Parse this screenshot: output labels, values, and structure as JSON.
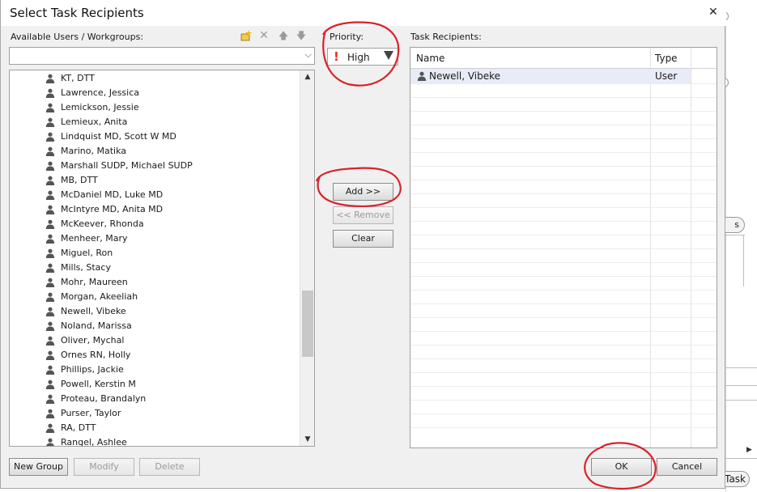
{
  "dialog": {
    "title": "Select Task Recipients",
    "close_glyph": "✕"
  },
  "available": {
    "label": "Available Users / Workgroups:",
    "search_value": "",
    "users": [
      "KT, DTT",
      "Lawrence, Jessica",
      "Lemickson, Jessie",
      "Lemieux, Anita",
      "Lindquist MD, Scott W MD",
      "Marino, Matika",
      "Marshall SUDP, Michael SUDP",
      "MB, DTT",
      "McDaniel MD, Luke MD",
      "McIntyre MD, Anita MD",
      "McKeever, Rhonda",
      "Menheer, Mary",
      "Miguel, Ron",
      "Mills, Stacy",
      "Mohr, Maureen",
      "Morgan, Akeeliah",
      "Newell, Vibeke",
      "Noland, Marissa",
      "Oliver, Mychal",
      "Ornes RN, Holly",
      "Phillips, Jackie",
      "Powell, Kerstin M",
      "Proteau, Brandalyn",
      "Purser, Taylor",
      "RA, DTT",
      "Rangel, Ashlee"
    ],
    "toolbar_icons": [
      "new-workgroup-icon",
      "delete-icon",
      "move-up-icon",
      "move-down-icon"
    ]
  },
  "priority": {
    "label": "Priority:",
    "value": "High",
    "flag_glyph": "!"
  },
  "actions": {
    "add": "Add >>",
    "remove": "<< Remove",
    "clear": "Clear"
  },
  "recipients": {
    "label": "Task Recipients:",
    "columns": [
      "Name",
      "Type"
    ],
    "rows": [
      {
        "name": "Newell, Vibeke",
        "type": "User"
      }
    ]
  },
  "footer": {
    "new_group": "New Group",
    "modify": "Modify",
    "delete": "Delete",
    "ok": "OK",
    "cancel": "Cancel"
  },
  "background": {
    "pill_text": "s",
    "task_button": "Task"
  },
  "colors": {
    "annotation_red": "#d8232a",
    "priority_flag": "#e3311c",
    "selected_row": "#e8ecf6"
  }
}
